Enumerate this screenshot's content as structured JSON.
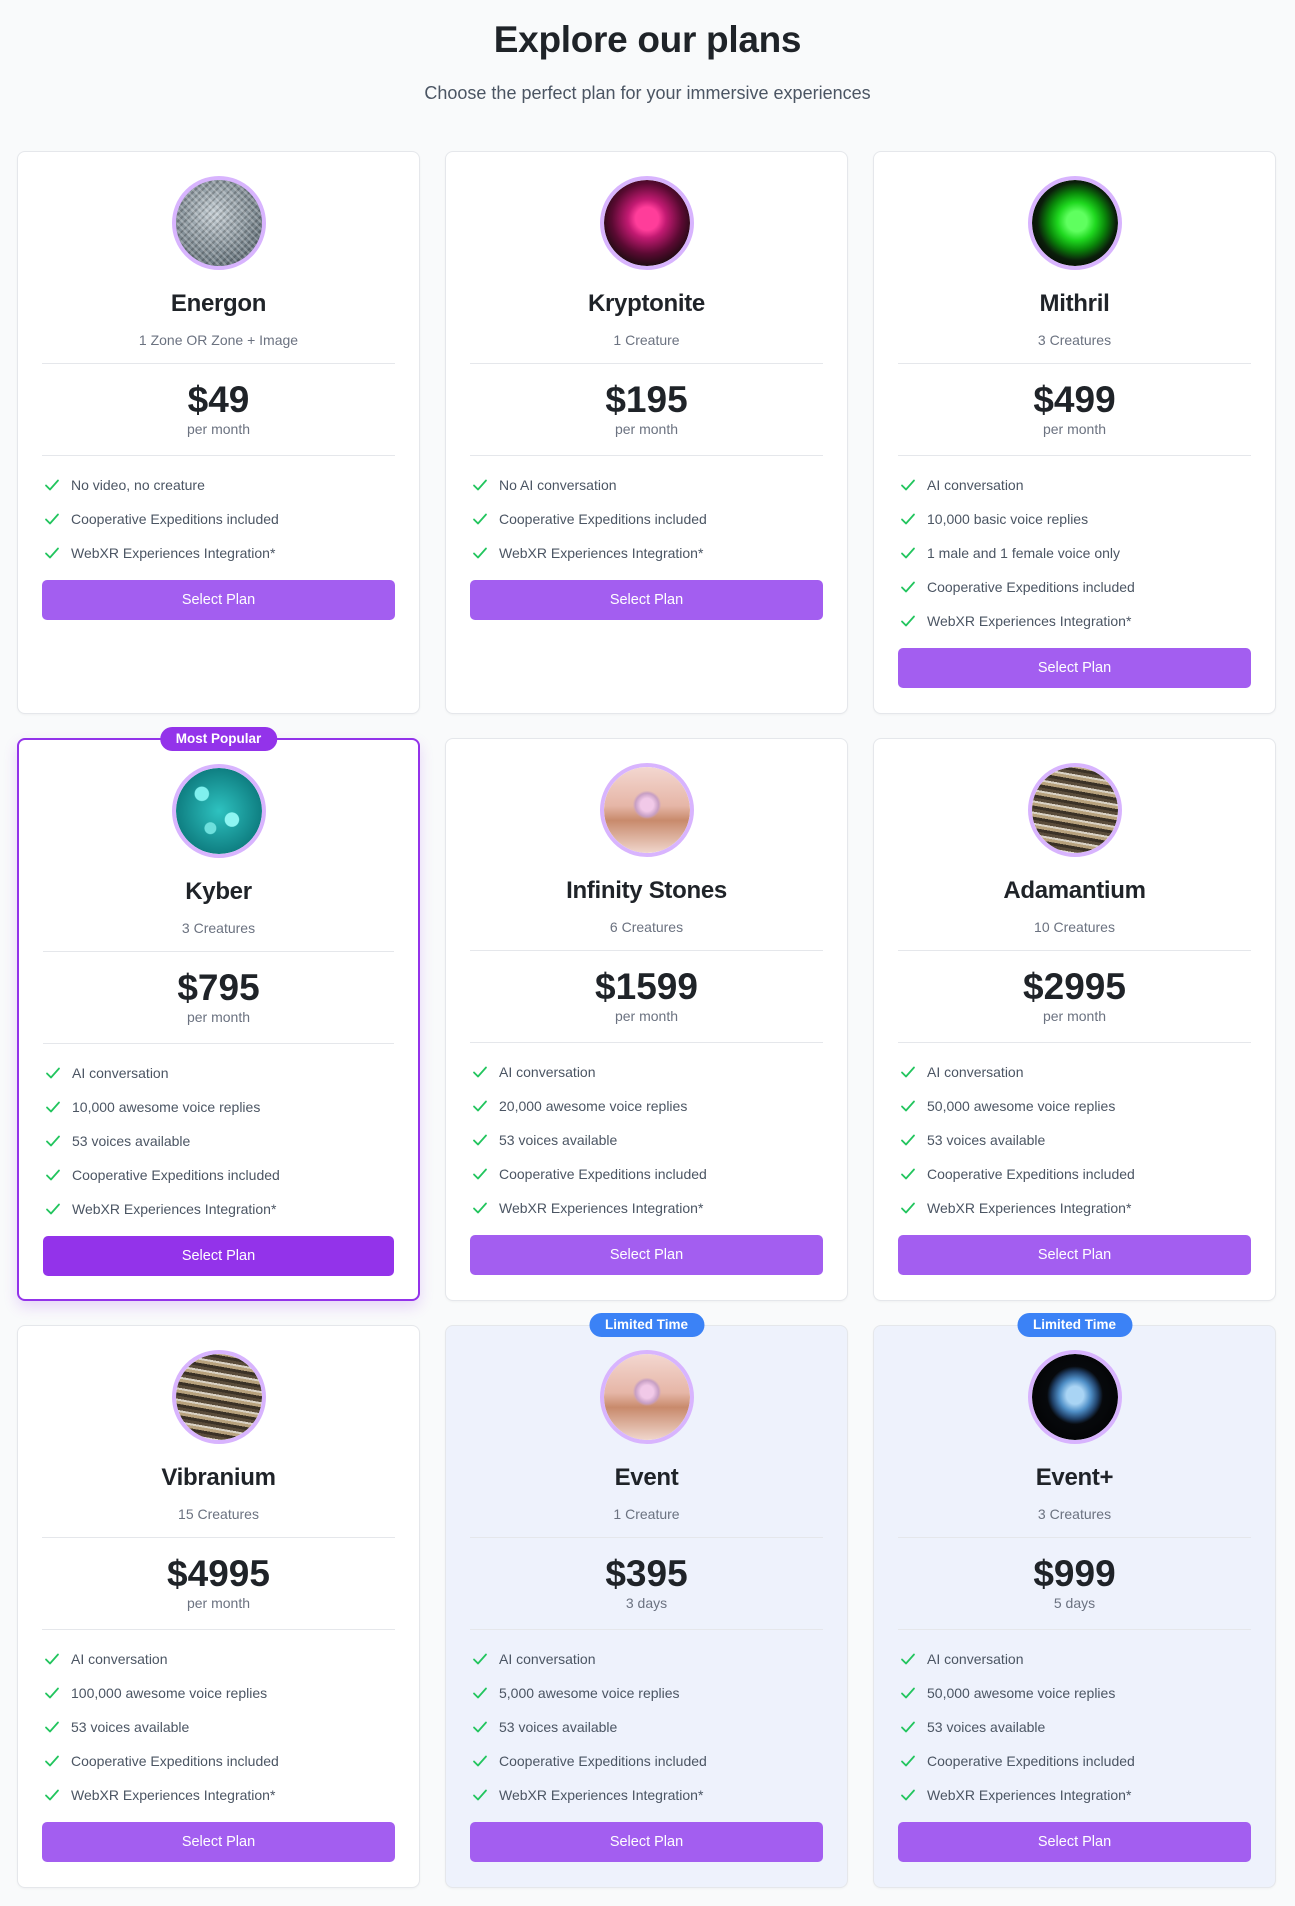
{
  "header": {
    "title": "Explore our plans",
    "subtitle": "Choose the perfect plan for your immersive experiences"
  },
  "button_label": "Select Plan",
  "colors": {
    "accent": "#a35ef0",
    "accent_strong": "#9333ea",
    "check": "#22c55e",
    "limited_badge": "#3b82f6",
    "limited_bg": "#eef2fc"
  },
  "plans": [
    {
      "name": "Energon",
      "subtitle": "1 Zone OR Zone + Image",
      "price": "$49",
      "period": "per month",
      "image": "metallic-mesh-gem",
      "features": [
        "No video, no creature",
        "Cooperative Expeditions included",
        "WebXR Experiences Integration*"
      ]
    },
    {
      "name": "Kryptonite",
      "subtitle": "1 Creature",
      "price": "$195",
      "period": "per month",
      "image": "pink-glowing-crystal-cube",
      "features": [
        "No AI conversation",
        "Cooperative Expeditions included",
        "WebXR Experiences Integration*"
      ]
    },
    {
      "name": "Mithril",
      "subtitle": "3 Creatures",
      "price": "$499",
      "period": "per month",
      "image": "green-glowing-rock",
      "features": [
        "AI conversation",
        "10,000 basic voice replies",
        "1 male and 1 female voice only",
        "Cooperative Expeditions included",
        "WebXR Experiences Integration*"
      ]
    },
    {
      "name": "Kyber",
      "subtitle": "3 Creatures",
      "price": "$795",
      "period": "per month",
      "badge": "Most Popular",
      "image": "teal-crystals",
      "features": [
        "AI conversation",
        "10,000 awesome voice replies",
        "53 voices available",
        "Cooperative Expeditions included",
        "WebXR Experiences Integration*"
      ]
    },
    {
      "name": "Infinity Stones",
      "subtitle": "6 Creatures",
      "price": "$1599",
      "period": "per month",
      "image": "diamond-ring",
      "features": [
        "AI conversation",
        "20,000 awesome voice replies",
        "53 voices available",
        "Cooperative Expeditions included",
        "WebXR Experiences Integration*"
      ]
    },
    {
      "name": "Adamantium",
      "subtitle": "10 Creatures",
      "price": "$2995",
      "period": "per month",
      "image": "metal-wire-texture",
      "features": [
        "AI conversation",
        "50,000 awesome voice replies",
        "53 voices available",
        "Cooperative Expeditions included",
        "WebXR Experiences Integration*"
      ]
    },
    {
      "name": "Vibranium",
      "subtitle": "15 Creatures",
      "price": "$4995",
      "period": "per month",
      "image": "metal-wire-texture",
      "features": [
        "AI conversation",
        "100,000 awesome voice replies",
        "53 voices available",
        "Cooperative Expeditions included",
        "WebXR Experiences Integration*"
      ]
    },
    {
      "name": "Event",
      "subtitle": "1 Creature",
      "price": "$395",
      "period": "3 days",
      "badge": "Limited Time",
      "image": "diamond-ring",
      "features": [
        "AI conversation",
        "5,000 awesome voice replies",
        "53 voices available",
        "Cooperative Expeditions included",
        "WebXR Experiences Integration*"
      ]
    },
    {
      "name": "Event+",
      "subtitle": "3 Creatures",
      "price": "$999",
      "period": "5 days",
      "badge": "Limited Time",
      "image": "blue-crystal-on-black",
      "features": [
        "AI conversation",
        "50,000 awesome voice replies",
        "53 voices available",
        "Cooperative Expeditions included",
        "WebXR Experiences Integration*"
      ]
    }
  ]
}
